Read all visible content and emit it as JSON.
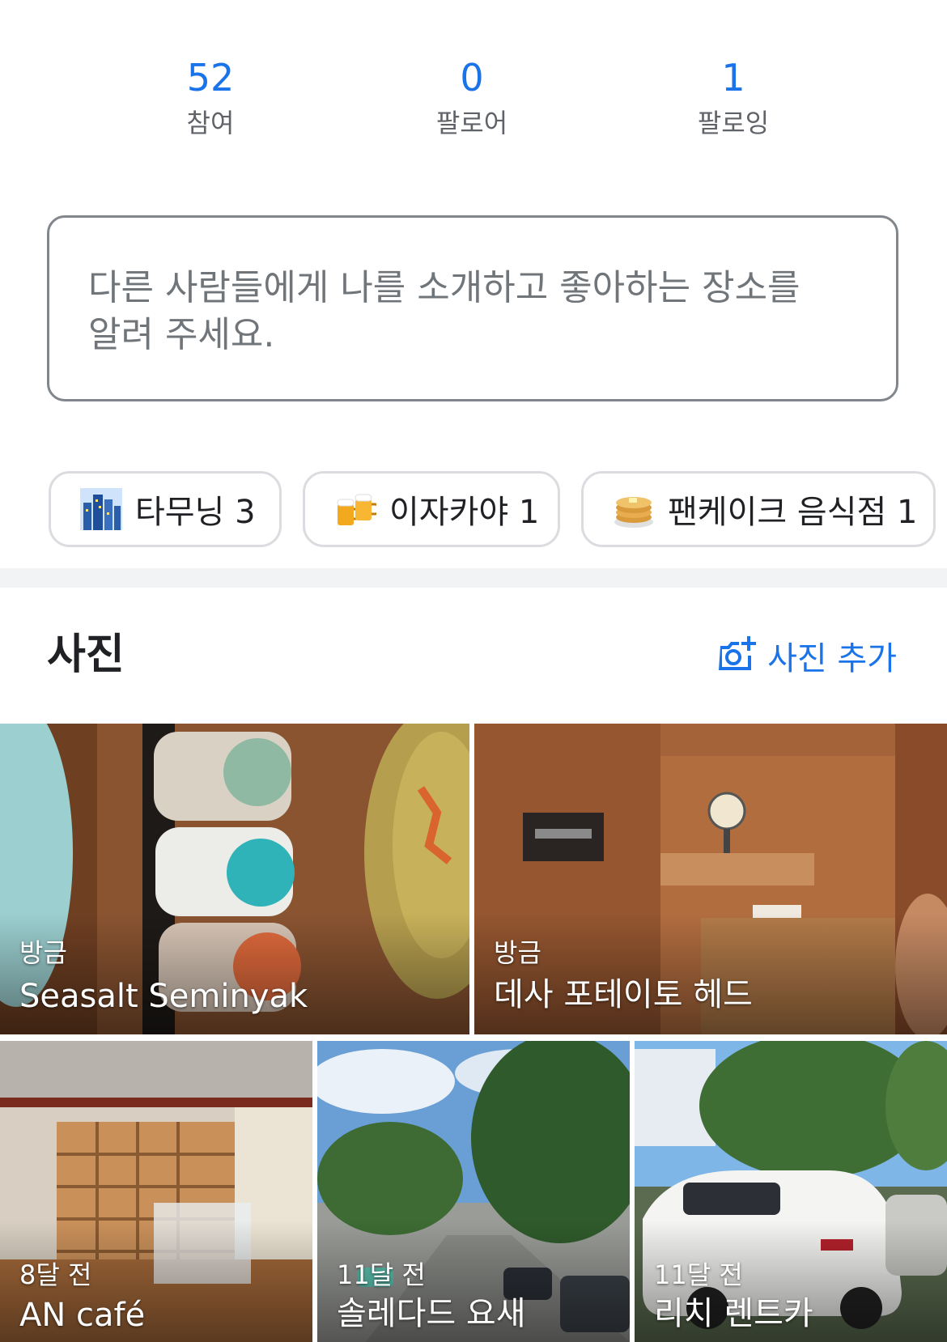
{
  "stats": [
    {
      "value": "52",
      "label": "참여"
    },
    {
      "value": "0",
      "label": "팔로어"
    },
    {
      "value": "1",
      "label": "팔로잉"
    }
  ],
  "intro": {
    "placeholder_line1": "다른 사람들에게 나를 소개하고 좋아하는 장소를",
    "placeholder_line2": "알려 주세요."
  },
  "chips": [
    {
      "label": "타무닝 3",
      "icon": "cityscape-icon"
    },
    {
      "label": "이자카야 1",
      "icon": "beer-mugs-icon"
    },
    {
      "label": "팬케이크 음식점 1",
      "icon": "pancakes-icon"
    }
  ],
  "photos": {
    "title": "사진",
    "add_label": "사진 추가",
    "add_icon": "add-photo-camera-icon",
    "tiles": [
      {
        "time": "방금",
        "place": "Seasalt Seminyak"
      },
      {
        "time": "방금",
        "place": "데사 포테이토 헤드"
      },
      {
        "time": "8달 전",
        "place": "AN café"
      },
      {
        "time": "11달 전",
        "place": "솔레다드 요새"
      },
      {
        "time": "11달 전",
        "place": "리치 렌트카"
      }
    ]
  },
  "colors": {
    "accent": "#1a73e8",
    "muted": "#5f6368",
    "border": "#dadce0",
    "divider": "#f1f3f4"
  }
}
